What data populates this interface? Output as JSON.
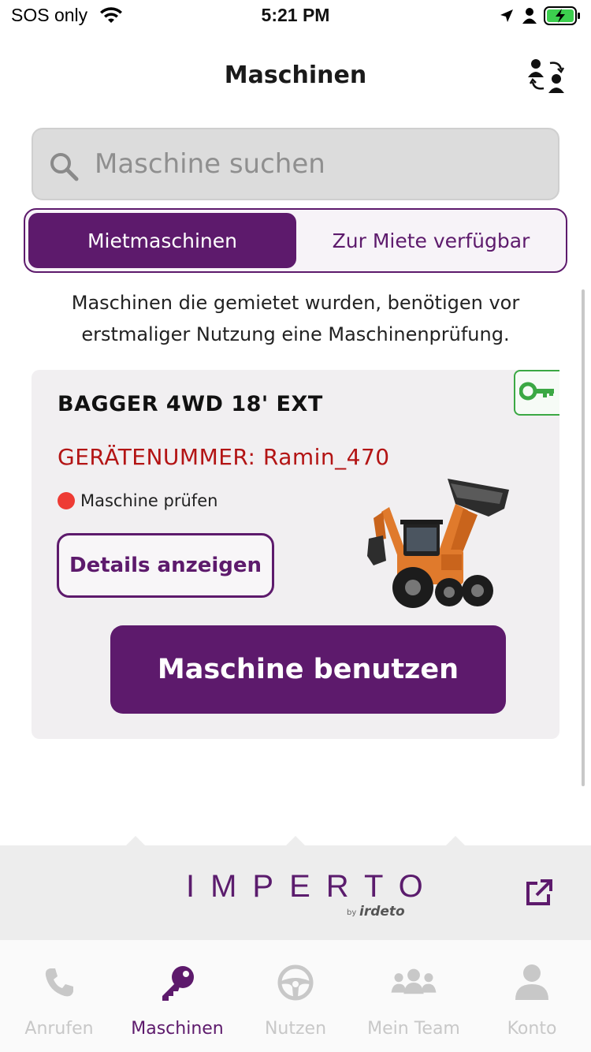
{
  "status_bar": {
    "carrier": "SOS only",
    "time": "5:21 PM"
  },
  "header": {
    "title": "Maschinen",
    "switch_icon": "user-switch-icon"
  },
  "search": {
    "placeholder": "Maschine suchen",
    "icon": "search-icon"
  },
  "segments": {
    "active": "Mietmaschinen",
    "inactive": "Zur Miete verfügbar"
  },
  "info_text": "Maschinen die gemietet wurden, benötigen vor erstmaliger Nutzung eine Maschinenprüfung.",
  "card": {
    "machine_name": "BAGGER 4WD 18' EXT",
    "device_number": "GERÄTENUMMER: Ramin_470",
    "status_text": "Maschine prüfen",
    "status_color": "#ee3b34",
    "key_badge_icon": "key-icon",
    "key_badge_color": "#3ba844",
    "details_button": "Details anzeigen",
    "use_button": "Maschine benutzen"
  },
  "brand": {
    "logo": "IMPERTO",
    "by": "by",
    "sub_logo": "irdeto"
  },
  "tabs": [
    {
      "label": "Anrufen",
      "icon": "phone-icon",
      "active": false
    },
    {
      "label": "Maschinen",
      "icon": "key-icon",
      "active": true
    },
    {
      "label": "Nutzen",
      "icon": "steering-wheel-icon",
      "active": false
    },
    {
      "label": "Mein Team",
      "icon": "team-icon",
      "active": false
    },
    {
      "label": "Konto",
      "icon": "account-icon",
      "active": false
    }
  ],
  "colors": {
    "primary": "#5d1a6c",
    "danger": "#b31414",
    "success": "#3ba844"
  }
}
